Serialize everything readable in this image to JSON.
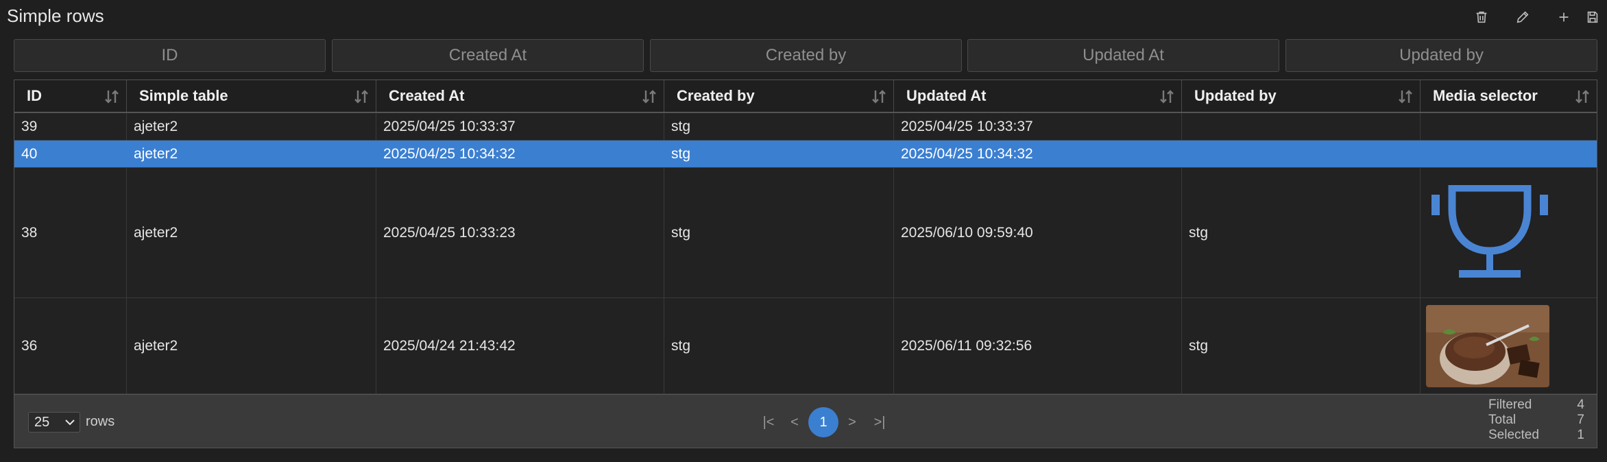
{
  "title": "Simple rows",
  "toolbar": [
    {
      "name": "delete-icon",
      "label": "Delete"
    },
    {
      "name": "edit-icon",
      "label": "Edit"
    },
    {
      "name": "add-icon",
      "label": "Add"
    },
    {
      "name": "save-icon",
      "label": "Save"
    }
  ],
  "filters": [
    "ID",
    "Created At",
    "Created by",
    "Updated At",
    "Updated by"
  ],
  "columns": [
    "ID",
    "Simple table",
    "Created At",
    "Created by",
    "Updated At",
    "Updated by",
    "Media selector"
  ],
  "rows": [
    {
      "id": "39",
      "simple_table": "ajeter2",
      "created_at": "2025/04/25 10:33:37",
      "created_by": "stg",
      "updated_at": "2025/04/25 10:33:37",
      "updated_by": "",
      "media": ""
    },
    {
      "id": "40",
      "simple_table": "ajeter2",
      "created_at": "2025/04/25 10:34:32",
      "created_by": "stg",
      "updated_at": "2025/04/25 10:34:32",
      "updated_by": "",
      "media": "",
      "selected": true
    },
    {
      "id": "38",
      "simple_table": "ajeter2",
      "created_at": "2025/04/25 10:33:23",
      "created_by": "stg",
      "updated_at": "2025/06/10 09:59:40",
      "updated_by": "stg",
      "media": "trophy-icon"
    },
    {
      "id": "36",
      "simple_table": "ajeter2",
      "created_at": "2025/04/24 21:43:42",
      "created_by": "stg",
      "updated_at": "2025/06/11 09:32:56",
      "updated_by": "stg",
      "media": "chocolate-mousse-image"
    }
  ],
  "footer": {
    "page_size": "25",
    "rows_label": "rows",
    "pager": {
      "first": "|<",
      "prev": "<",
      "current": "1",
      "next": ">",
      "last": ">|"
    },
    "stats": [
      {
        "label": "Filtered",
        "value": "4"
      },
      {
        "label": "Total",
        "value": "7"
      },
      {
        "label": "Selected",
        "value": "1"
      }
    ]
  },
  "colors": {
    "accent": "#3b7fd1",
    "background": "#1f1f1f"
  }
}
